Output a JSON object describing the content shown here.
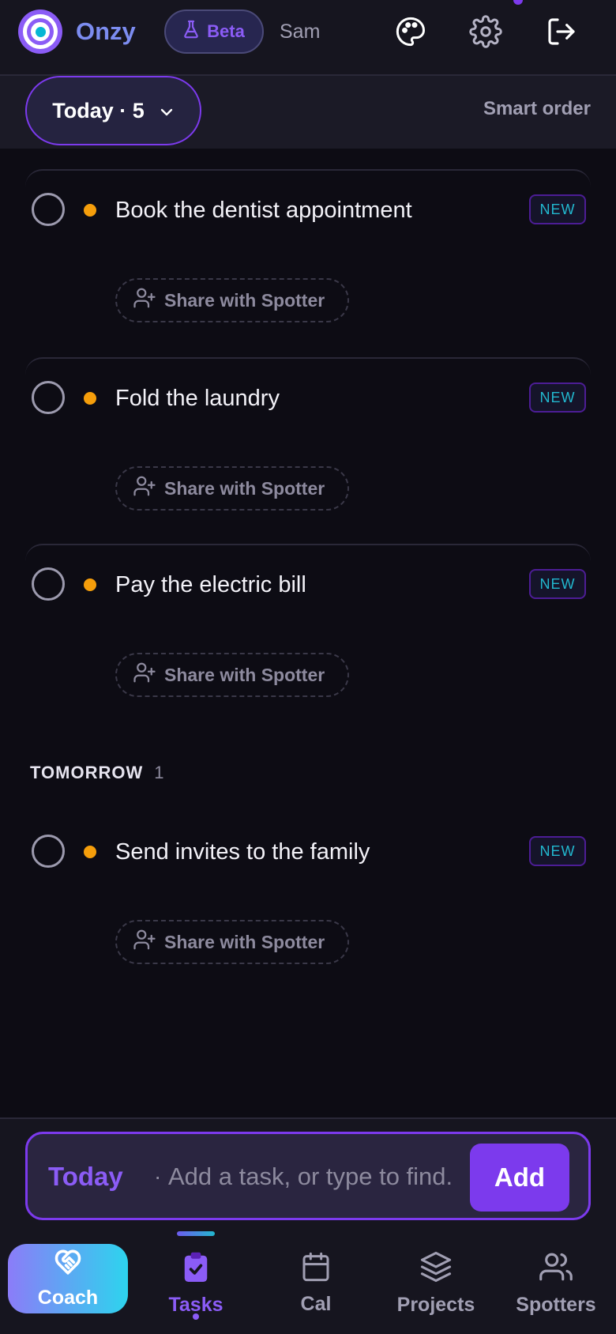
{
  "header": {
    "brand": "Onzy",
    "beta_label": "Beta",
    "user_name": "Sam"
  },
  "subbar": {
    "filter_label": "Today · 5",
    "sort_label": "Smart order"
  },
  "tasks": [
    {
      "title": "Book the dentist appointment",
      "badge": "NEW",
      "share_label": "Share with Spotter"
    },
    {
      "title": "Fold the laundry",
      "badge": "NEW",
      "share_label": "Share with Spotter"
    },
    {
      "title": "Pay the electric bill",
      "badge": "NEW",
      "share_label": "Share with Spotter"
    }
  ],
  "tomorrow": {
    "heading": "TOMORROW",
    "count": "1",
    "tasks": [
      {
        "title": "Send invites to the family",
        "badge": "NEW",
        "share_label": "Share with Spotter"
      }
    ]
  },
  "composer": {
    "context": "Today",
    "separator": "·",
    "placeholder": "Add a task, or type to find.",
    "add_label": "Add"
  },
  "nav": {
    "coach": "Coach",
    "tasks": "Tasks",
    "cal": "Cal",
    "projects": "Projects",
    "spotters": "Spotters"
  },
  "colors": {
    "accent": "#7c3aed",
    "priority_dot": "#f59e0b",
    "badge_text": "#22b8cf"
  },
  "icons": {
    "header": [
      "palette-icon",
      "gear-icon",
      "logout-icon"
    ],
    "share": "user-plus-icon",
    "nav": [
      "heart-handshake-icon",
      "clipboard-check-icon",
      "calendar-icon",
      "layers-icon",
      "users-icon"
    ]
  }
}
